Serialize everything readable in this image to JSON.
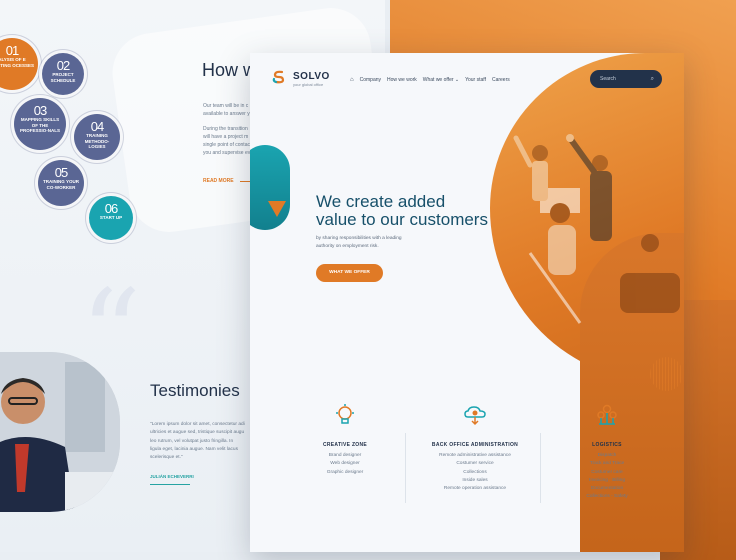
{
  "colors": {
    "orange": "#e07a26",
    "teal": "#1aa4b0",
    "navy": "#22324a",
    "step_blue": "#5a6694"
  },
  "left_page": {
    "how_title": "How w",
    "para1": [
      "Our team will be in c",
      "available to answer y"
    ],
    "para2": [
      "During the transition",
      "will have a project m",
      "single point of contac",
      "you and supervise ev"
    ],
    "read_more": "READ MORE",
    "steps": [
      {
        "num": "01",
        "label": "ALYSIS OF E EXISTING OCESSES"
      },
      {
        "num": "02",
        "label": "PROJECT SCHEDULE"
      },
      {
        "num": "03",
        "label": "MAPPING SKILLS OF THE PROFESSIO-NALS"
      },
      {
        "num": "04",
        "label": "TRAINING METHODO-LOGIES"
      },
      {
        "num": "05",
        "label": "TRAINING YOUR CO-WORKER"
      },
      {
        "num": "06",
        "label": "START UP"
      }
    ],
    "testimonies_title": "Testimonies",
    "testimony_lines": [
      "\"Lorem ipsum dolor sit amet, consectetur adi",
      "ultricies et augue sed, tristique suscipit augu",
      "leo rutrum, vel volutpat justo fringilla. In",
      "ligula eget, lacinia augue. Nam velit lacus",
      "scelerisque et.\""
    ],
    "testimony_author": "JULIÁN ECHEVERRI"
  },
  "header": {
    "brand": "SOLVO",
    "tagline": "your global office",
    "nav": [
      "Company",
      "How we work",
      "What we offer ⌄",
      "Your staff",
      "Careers"
    ],
    "search_placeholder": "Search"
  },
  "hero": {
    "title_line1": "We create added",
    "title_line2": "value to our customers",
    "subtitle_line1": "by sharing responsibilities with a leading",
    "subtitle_line2": "authority on employment risk.",
    "cta": "WHAT WE OFFER"
  },
  "services": [
    {
      "icon": "idea-icon",
      "title": "CREATIVE ZONE",
      "items": [
        "Brand designer",
        "Web designer",
        "Graphic designer"
      ]
    },
    {
      "icon": "cloud-support-icon",
      "title": "BACK OFFICE ADMINISTRATION",
      "items": [
        "Remote administrative assistance",
        "Costumer service",
        "Collections",
        "Inside sales",
        "Remote operation assistance"
      ]
    },
    {
      "icon": "logistics-icon",
      "title": "LOGISTICS",
      "items": [
        "Dispatch",
        "Track and Trace",
        "Costumer care",
        "Invoicing - Billing",
        "Documentation",
        "Collections - Safety"
      ]
    }
  ]
}
